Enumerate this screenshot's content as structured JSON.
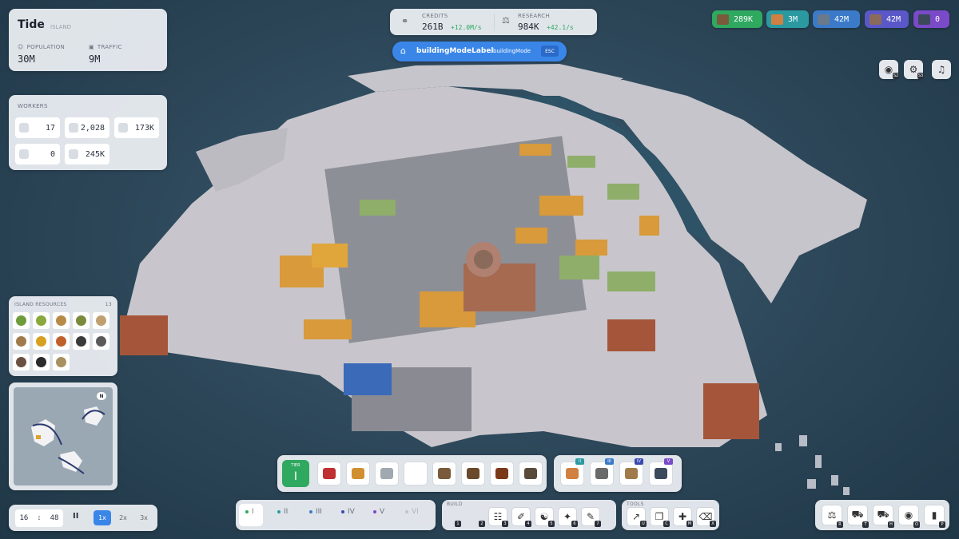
{
  "city": {
    "name": "Tide",
    "type": "ISLAND",
    "population_label": "POPULATION",
    "population": "30M",
    "traffic_label": "TRAFFIC",
    "traffic": "9M"
  },
  "workers": {
    "title": "WORKERS",
    "values": [
      "17",
      "2,028",
      "173K",
      "0",
      "245K"
    ]
  },
  "resources": {
    "title": "ISLAND RESOURCES",
    "count": "13",
    "colors": [
      "#6e9c3a",
      "#8aa83c",
      "#b88a48",
      "#7a8a3a",
      "#c0a070",
      "#a07a4a",
      "#d8a020",
      "#c0602a",
      "#3a3a3a",
      "#5a5a5a",
      "#6a5040",
      "#2a2a2a",
      "#a89060"
    ]
  },
  "minimap": {
    "north": "N"
  },
  "economy": {
    "credits_label": "CREDITS",
    "credits": "261B",
    "credits_rate": "+12.0M/s",
    "research_label": "RESEARCH",
    "research": "984K",
    "research_rate": "+42.1/s"
  },
  "mode": {
    "label": "buildingModeLabel",
    "value": "buildingMode",
    "key": "ESC"
  },
  "stock": [
    {
      "value": "289K",
      "bg": "#2fa860",
      "sw": "#7a5a3a"
    },
    {
      "value": "3M",
      "bg": "#2a9aa0",
      "sw": "#d08040"
    },
    {
      "value": "42M",
      "bg": "#3a7ac8",
      "sw": "#6a7a8a"
    },
    {
      "value": "42M",
      "bg": "#5a58c8",
      "sw": "#8a6a5a"
    },
    {
      "value": "0",
      "bg": "#7a4ac8",
      "sw": "#3a4a5a"
    }
  ],
  "tiers": {
    "current_label": "TIER",
    "current": "I",
    "names": [
      "I",
      "II",
      "III",
      "IV",
      "V",
      "VI"
    ],
    "colors": [
      "#2fa860",
      "#2a9aa0",
      "#3a7ac8",
      "#3a4ab0",
      "#7a4ac8",
      "#c0c4c8"
    ]
  },
  "tier_slots": {
    "colors": [
      "#c03030",
      "#d09030",
      "#a0a8b0",
      "#ffffff",
      "#7a5a3a",
      "#6a4a2a",
      "#7a3a1a",
      "#5a4a3a"
    ]
  },
  "upgrade_slots": {
    "badges": [
      "II",
      "III",
      "IV",
      "V"
    ],
    "colors": [
      "#d08040",
      "#6a6a6a",
      "#a07a4a",
      "#3a4a5a"
    ]
  },
  "time": {
    "hours": "16",
    "minutes": "48",
    "pause": "II",
    "speeds": [
      "1x",
      "2x",
      "3x"
    ]
  },
  "build": {
    "title": "BUILD",
    "keys": [
      "1",
      "2",
      "3",
      "4",
      "5",
      "6",
      "7"
    ]
  },
  "tools": {
    "title": "TOOLS",
    "keys": [
      "U",
      "C",
      "M",
      "X"
    ]
  },
  "right_tools": {
    "keys": [
      "R",
      "T",
      "H",
      "O",
      "P"
    ]
  },
  "corner_buttons": {
    "camera_key": "S2",
    "settings_key": "S3"
  }
}
